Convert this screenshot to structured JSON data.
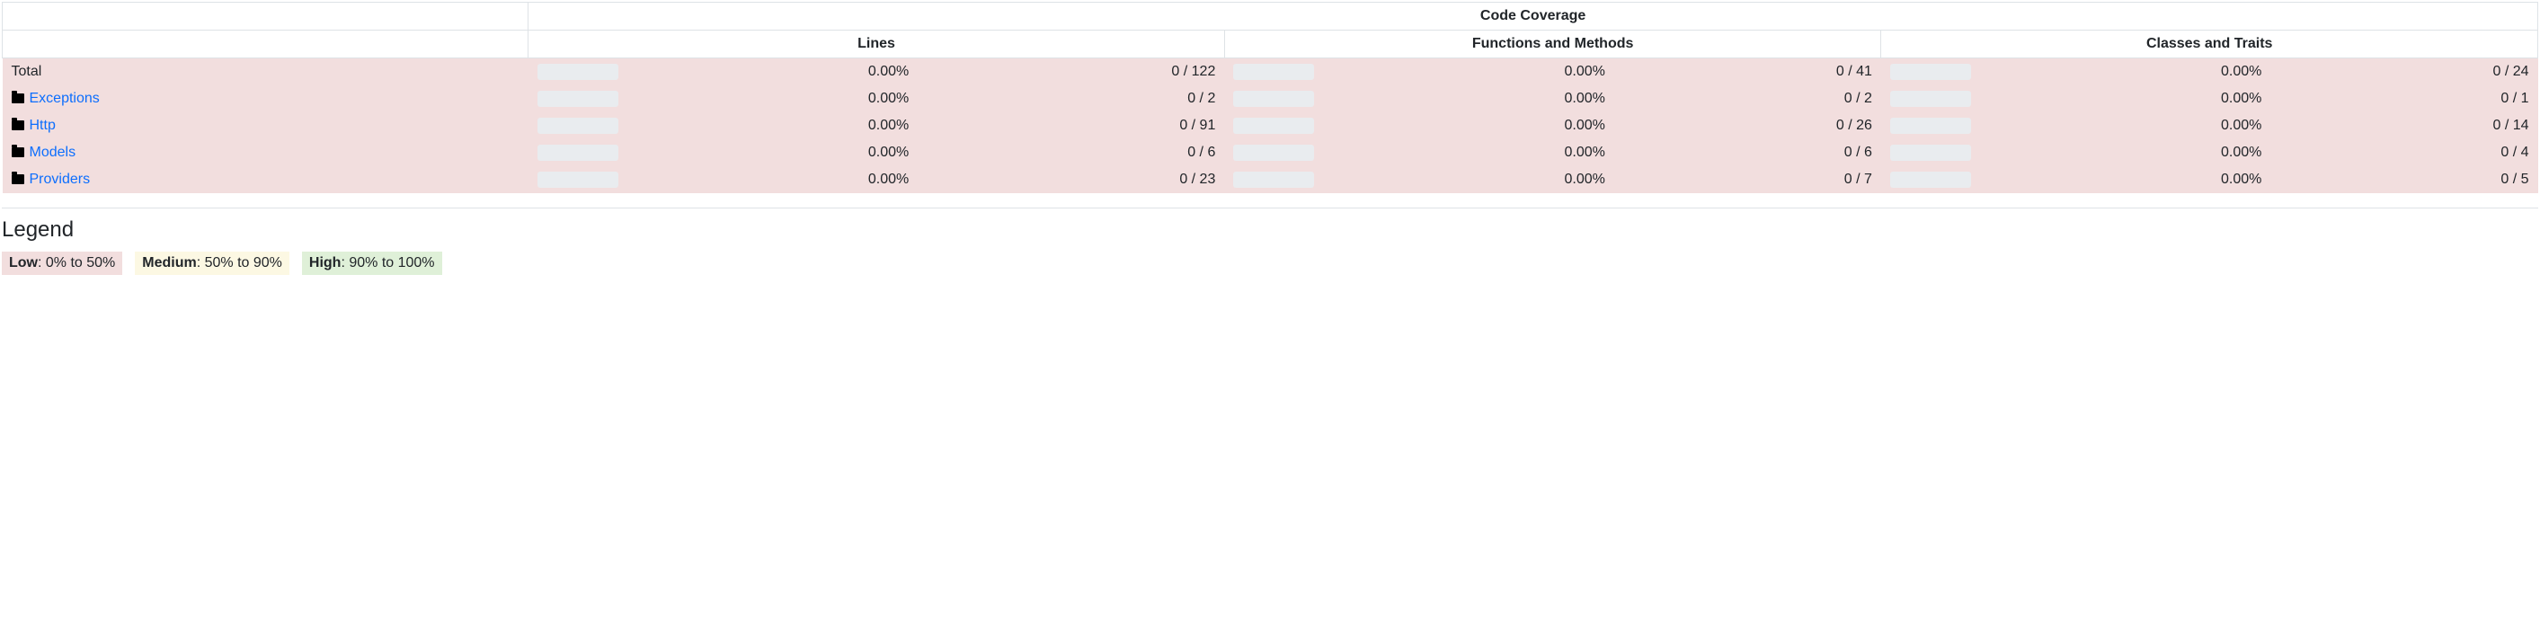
{
  "header": {
    "title": "Code Coverage",
    "columns": [
      "Lines",
      "Functions and Methods",
      "Classes and Traits"
    ]
  },
  "rows": [
    {
      "name": "Total",
      "is_link": false,
      "lines_pct": "0.00%",
      "lines_ratio": "0 / 122",
      "functions_pct": "0.00%",
      "functions_ratio": "0 / 41",
      "classes_pct": "0.00%",
      "classes_ratio": "0 / 24"
    },
    {
      "name": "Exceptions",
      "is_link": true,
      "lines_pct": "0.00%",
      "lines_ratio": "0 / 2",
      "functions_pct": "0.00%",
      "functions_ratio": "0 / 2",
      "classes_pct": "0.00%",
      "classes_ratio": "0 / 1"
    },
    {
      "name": "Http",
      "is_link": true,
      "lines_pct": "0.00%",
      "lines_ratio": "0 / 91",
      "functions_pct": "0.00%",
      "functions_ratio": "0 / 26",
      "classes_pct": "0.00%",
      "classes_ratio": "0 / 14"
    },
    {
      "name": "Models",
      "is_link": true,
      "lines_pct": "0.00%",
      "lines_ratio": "0 / 6",
      "functions_pct": "0.00%",
      "functions_ratio": "0 / 6",
      "classes_pct": "0.00%",
      "classes_ratio": "0 / 4"
    },
    {
      "name": "Providers",
      "is_link": true,
      "lines_pct": "0.00%",
      "lines_ratio": "0 / 23",
      "functions_pct": "0.00%",
      "functions_ratio": "0 / 7",
      "classes_pct": "0.00%",
      "classes_ratio": "0 / 5"
    }
  ],
  "legend": {
    "title": "Legend",
    "low_label": "Low",
    "low_range": ": 0% to 50%",
    "medium_label": "Medium",
    "medium_range": ": 50% to 90%",
    "high_label": "High",
    "high_range": ": 90% to 100%"
  }
}
